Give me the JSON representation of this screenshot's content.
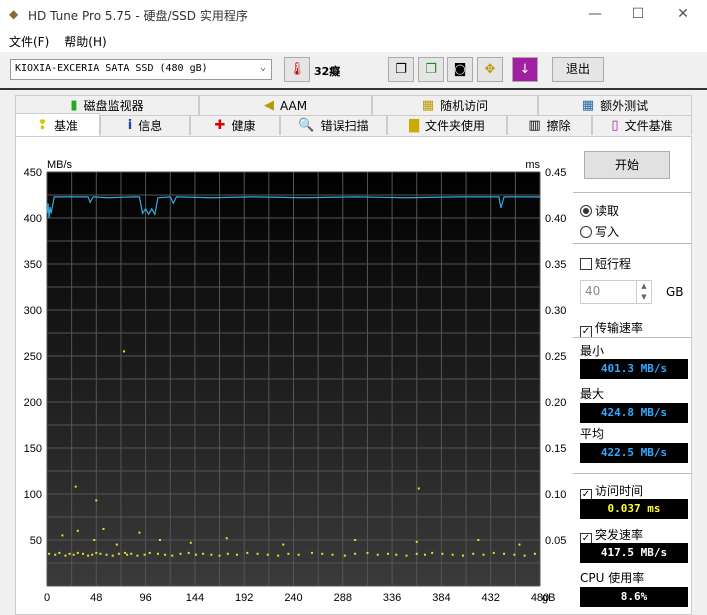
{
  "window": {
    "title": "HD Tune Pro 5.75 - 硬盘/SSD 实用程序"
  },
  "menu": [
    "文件(F)",
    "帮助(H)"
  ],
  "toolbar": {
    "drive": "KIOXIA-EXCERIA SATA SSD (480 gB)",
    "temperature": "32癡",
    "exit": "退出"
  },
  "tabs_top": [
    "磁盘监视器",
    "AAM",
    "随机访问",
    "额外测试"
  ],
  "tabs_bottom": [
    "基准",
    "信息",
    "健康",
    "错误扫描",
    "文件夹使用",
    "擦除",
    "文件基准"
  ],
  "side": {
    "start": "开始",
    "read": "读取",
    "write": "写入",
    "short_stroke": "短行程",
    "short_stroke_value": "40",
    "gb": "GB",
    "transfer_rate": "传输速率",
    "min_label": "最小",
    "min": "401.3 MB/s",
    "max_label": "最大",
    "max": "424.8 MB/s",
    "avg_label": "平均",
    "avg": "422.5 MB/s",
    "access_time": "访问时间",
    "access_value": "0.037 ms",
    "burst_rate": "突发速率",
    "burst_value": "417.5 MB/s",
    "cpu_label": "CPU 使用率",
    "cpu_value": "8.6%",
    "mode": "read",
    "short_stroke_checked": false,
    "transfer_checked": true,
    "access_checked": true,
    "burst_checked": true
  },
  "colors": {
    "transfer": "#33aadd",
    "access": "#e8e030",
    "lcd_blue": "#33aaff",
    "lcd_yellow": "#ffff33"
  },
  "chart_data": {
    "type": "line+scatter",
    "ylabel": "MB/s",
    "y2label": "ms",
    "xunit": "gB",
    "xlim": [
      0,
      480
    ],
    "ylim": [
      0,
      450
    ],
    "y2lim": [
      0,
      0.45
    ],
    "xticks": [
      0,
      48,
      96,
      144,
      192,
      240,
      288,
      336,
      384,
      432,
      480
    ],
    "yticks": [
      50,
      100,
      150,
      200,
      250,
      300,
      350,
      400,
      450
    ],
    "y2ticks": [
      0.05,
      0.1,
      0.15,
      0.2,
      0.25,
      0.3,
      0.35,
      0.4,
      0.45
    ],
    "grid": true,
    "transfer": {
      "x": [
        0,
        1,
        2,
        3,
        4,
        7,
        15,
        40,
        42,
        45,
        60,
        85,
        90,
        93,
        96,
        99,
        102,
        105,
        108,
        120,
        123,
        126,
        160,
        200,
        250,
        300,
        350,
        400,
        440,
        442,
        445,
        480
      ],
      "y": [
        405,
        416,
        400,
        412,
        405,
        423,
        423,
        423,
        417,
        423,
        422,
        423,
        423,
        405,
        410,
        404,
        410,
        404,
        422,
        423,
        416,
        423,
        422,
        423,
        422,
        423,
        422,
        423,
        423,
        411,
        423,
        423
      ]
    },
    "access_ms": {
      "x": [
        2,
        8,
        12,
        18,
        22,
        26,
        30,
        35,
        40,
        44,
        48,
        52,
        58,
        64,
        70,
        76,
        78,
        82,
        88,
        95,
        100,
        108,
        115,
        122,
        130,
        138,
        145,
        152,
        160,
        168,
        176,
        185,
        195,
        205,
        215,
        225,
        235,
        245,
        258,
        268,
        278,
        290,
        300,
        312,
        322,
        332,
        340,
        350,
        360,
        368,
        375,
        385,
        395,
        405,
        415,
        425,
        435,
        445,
        455,
        465,
        475,
        15,
        30,
        46,
        55,
        68,
        90,
        110,
        140,
        175,
        230,
        300,
        360,
        420,
        460,
        28,
        48,
        75,
        362
      ],
      "y": [
        0.035,
        0.034,
        0.036,
        0.033,
        0.035,
        0.034,
        0.036,
        0.035,
        0.033,
        0.034,
        0.036,
        0.035,
        0.034,
        0.033,
        0.035,
        0.036,
        0.034,
        0.035,
        0.033,
        0.034,
        0.036,
        0.035,
        0.034,
        0.033,
        0.035,
        0.036,
        0.034,
        0.035,
        0.034,
        0.033,
        0.035,
        0.034,
        0.036,
        0.035,
        0.034,
        0.033,
        0.035,
        0.034,
        0.036,
        0.035,
        0.034,
        0.033,
        0.035,
        0.036,
        0.034,
        0.035,
        0.034,
        0.033,
        0.035,
        0.034,
        0.036,
        0.035,
        0.034,
        0.033,
        0.035,
        0.034,
        0.036,
        0.035,
        0.034,
        0.033,
        0.035,
        0.055,
        0.06,
        0.05,
        0.062,
        0.045,
        0.058,
        0.05,
        0.047,
        0.052,
        0.045,
        0.05,
        0.048,
        0.05,
        0.045,
        0.108,
        0.093,
        0.255,
        0.106
      ]
    }
  }
}
